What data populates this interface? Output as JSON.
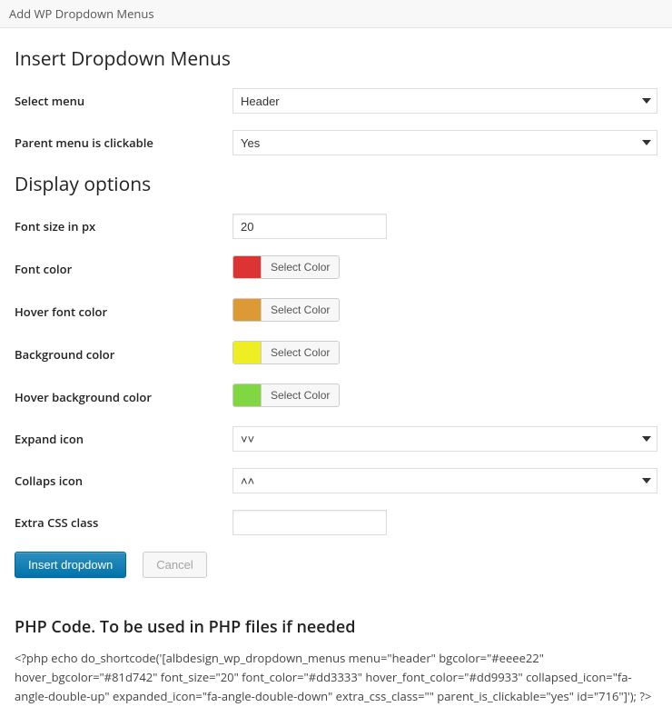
{
  "topbar": {
    "title": "Add WP Dropdown Menus"
  },
  "section1": {
    "heading": "Insert Dropdown Menus",
    "fields": {
      "select_menu": {
        "label": "Select menu",
        "value": "Header"
      },
      "parent_clickable": {
        "label": "Parent menu is clickable",
        "value": "Yes"
      }
    }
  },
  "section2": {
    "heading": "Display options",
    "fields": {
      "font_size": {
        "label": "Font size in px",
        "value": "20"
      },
      "font_color": {
        "label": "Font color",
        "swatch": "#dd3333",
        "btn": "Select Color"
      },
      "hover_font_color": {
        "label": "Hover font color",
        "swatch": "#dd9933",
        "btn": "Select Color"
      },
      "bg_color": {
        "label": "Background color",
        "swatch": "#eeee22",
        "btn": "Select Color"
      },
      "hover_bg_color": {
        "label": "Hover background color",
        "swatch": "#81d742",
        "btn": "Select Color"
      },
      "expand_icon": {
        "label": "Expand icon",
        "glyph": "˅˅"
      },
      "collapse_icon": {
        "label": "Collaps icon",
        "glyph": "˄˄"
      },
      "extra_css": {
        "label": "Extra CSS class",
        "value": ""
      }
    }
  },
  "buttons": {
    "insert": "Insert dropdown",
    "cancel": "Cancel"
  },
  "php": {
    "heading": "PHP Code. To be used in PHP files if needed",
    "code": "<?php echo do_shortcode('[albdesign_wp_dropdown_menus menu=\"header\" bgcolor=\"#eeee22\" hover_bgcolor=\"#81d742\" font_size=\"20\" font_color=\"#dd3333\" hover_font_color=\"#dd9933\" collapsed_icon=\"fa-angle-double-up\" expanded_icon=\"fa-angle-double-down\" extra_css_class=\"\" parent_is_clickable=\"yes\" id=\"716\"]'); ?>"
  }
}
